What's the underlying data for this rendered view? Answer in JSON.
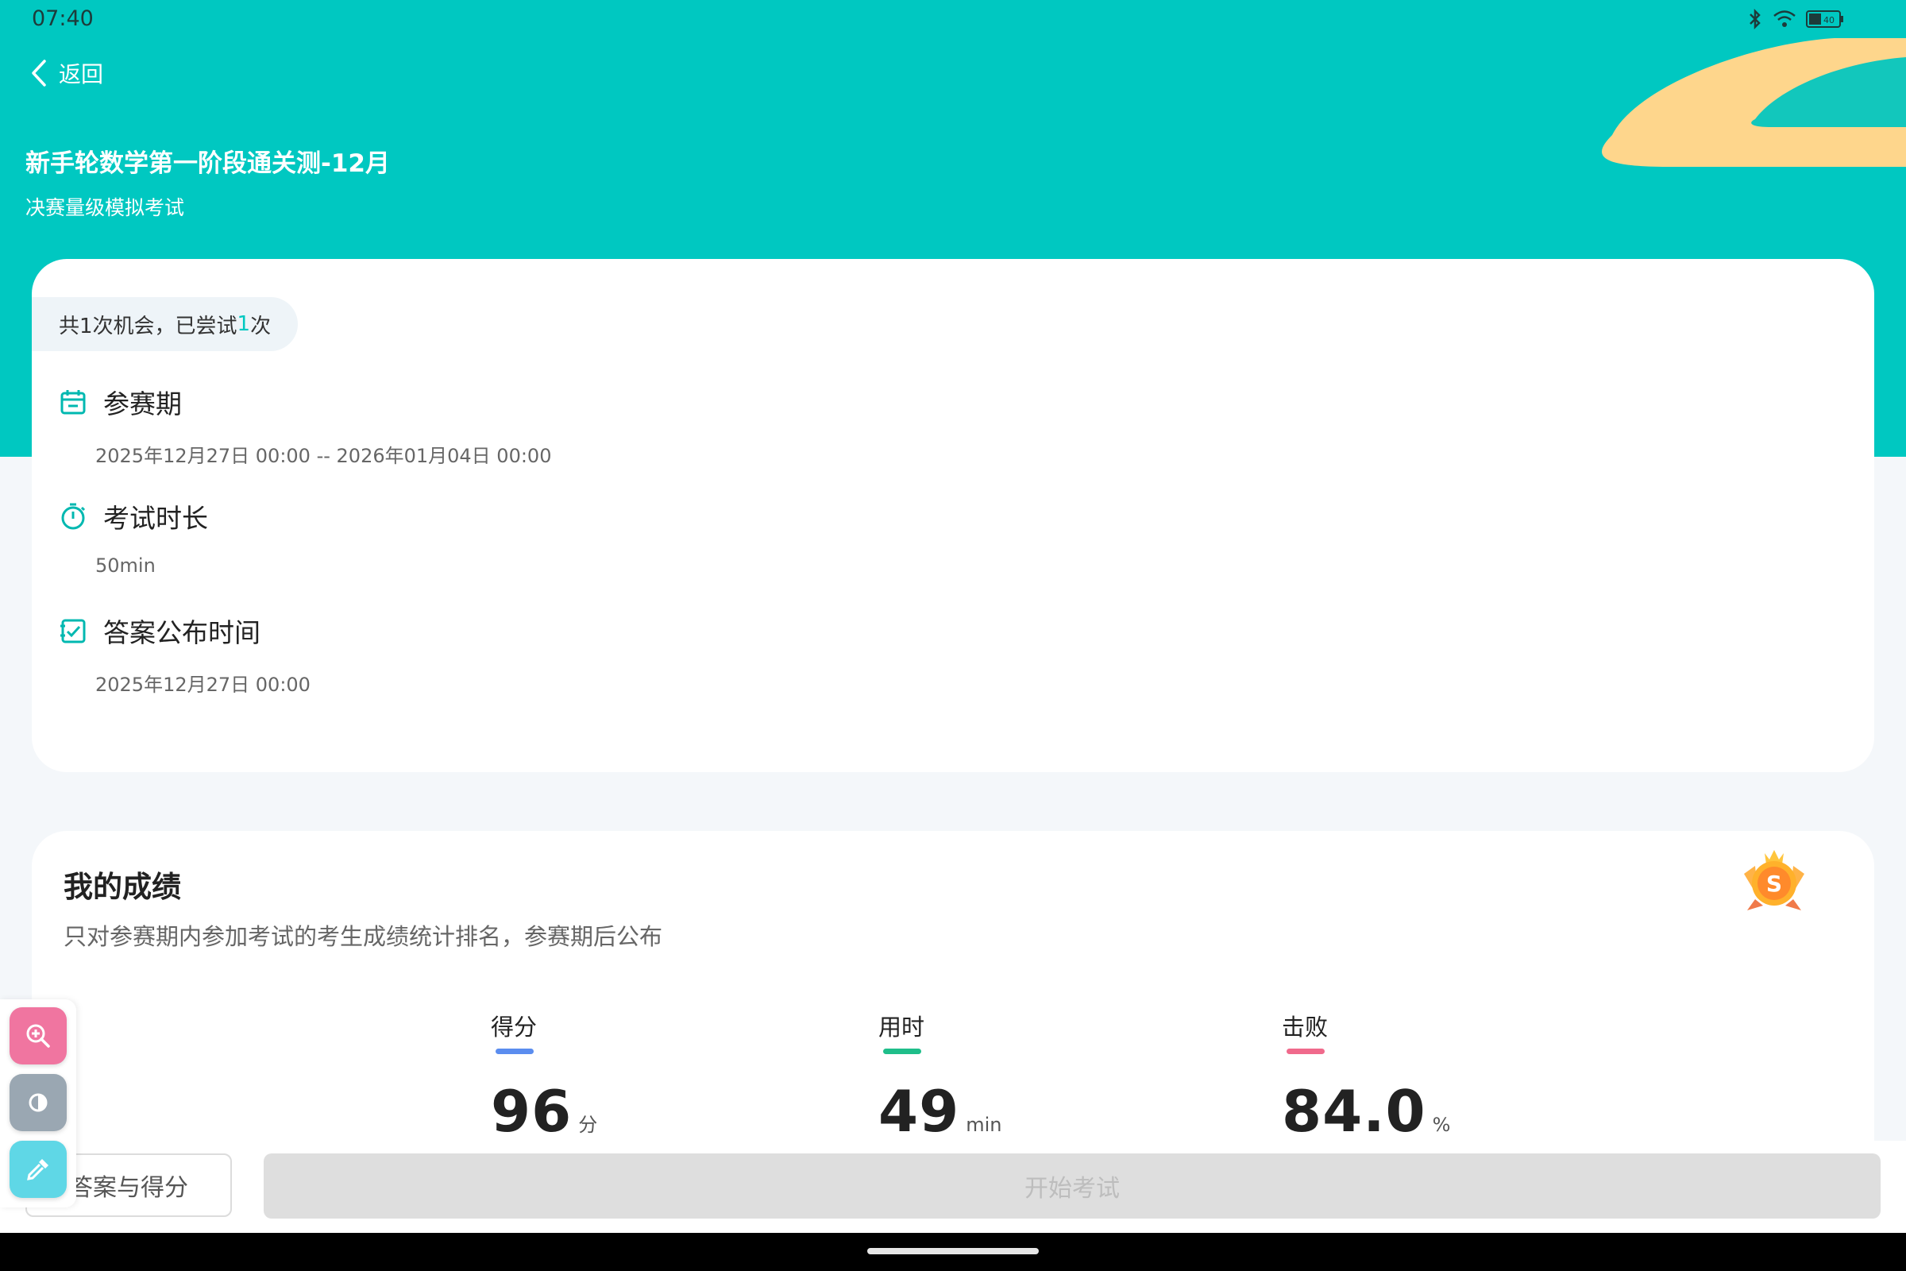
{
  "status_bar": {
    "time": "07:40",
    "battery": "40"
  },
  "header": {
    "back_label": "返回",
    "title": "新手轮数学第一阶段通关测-12月",
    "subtitle": "决赛量级模拟考试"
  },
  "info": {
    "chance_prefix": "共1次机会，已尝试",
    "chance_tried": "1",
    "chance_suffix": "次",
    "period_title": "参赛期",
    "period_value": "2025年12月27日 00:00  --  2026年01月04日 00:00",
    "duration_title": "考试时长",
    "duration_value": "50min",
    "answer_title": "答案公布时间",
    "answer_value": "2025年12月27日 00:00"
  },
  "score": {
    "title": "我的成绩",
    "desc": "只对参赛期内参加考试的考生成绩统计排名，参赛期后公布",
    "medal_letter": "S",
    "metrics": [
      {
        "label": "得分",
        "value": "96",
        "unit": "分",
        "color": "#5b8def"
      },
      {
        "label": "用时",
        "value": "49",
        "unit": "min",
        "color": "#1fbe8a"
      },
      {
        "label": "击败",
        "value": "84.0",
        "unit": "%",
        "color": "#f06a8c"
      }
    ]
  },
  "actions": {
    "answer_button": "答案与得分",
    "start_button": "开始考试"
  },
  "colors": {
    "brand": "#00c8c1",
    "accent_yellow": "#fed68c"
  }
}
